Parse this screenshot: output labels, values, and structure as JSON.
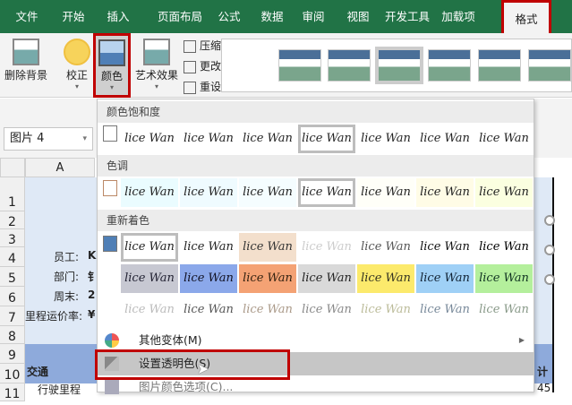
{
  "tabs": [
    "文件",
    "开始",
    "插入",
    "页面布局",
    "公式",
    "数据",
    "审阅",
    "视图",
    "开发工具",
    "加载项",
    "格式"
  ],
  "ribbon": {
    "remove_bg": "删除背景",
    "corrections": "校正",
    "color": "颜色",
    "artistic": "艺术效果",
    "compress": "压缩图片",
    "change": "更改图片",
    "reset": "重设图片"
  },
  "name_box": "图片 4",
  "column_a": "A",
  "rows": [
    "1",
    "2",
    "3",
    "4",
    "5",
    "6",
    "7",
    "8",
    "9",
    "10",
    "11"
  ],
  "cells": {
    "employee": "员工:",
    "dept": "部门:",
    "week": "周末:",
    "rate": "里程运价率:",
    "employee_v": "K",
    "dept_v": "钅",
    "week_v": "2",
    "rate_v": "¥",
    "traffic": "交通",
    "mileage": "行驶里程",
    "total": "计",
    "total_v": "45"
  },
  "menu": {
    "saturation": "颜色饱和度",
    "tone": "色调",
    "recolor": "重新着色",
    "sample": "lice Wan",
    "saturation_row": [
      {
        "bg": "#ffffff",
        "fg": "#222"
      },
      {
        "bg": "#ffffff",
        "fg": "#222"
      },
      {
        "bg": "#ffffff",
        "fg": "#222"
      },
      {
        "bg": "#ffffff",
        "fg": "#222",
        "sel": true
      },
      {
        "bg": "#ffffff",
        "fg": "#222"
      },
      {
        "bg": "#ffffff",
        "fg": "#222"
      },
      {
        "bg": "#ffffff",
        "fg": "#222"
      }
    ],
    "tone_row": [
      {
        "bg": "#eafcff",
        "fg": "#222"
      },
      {
        "bg": "#effbff",
        "fg": "#222"
      },
      {
        "bg": "#f5fdff",
        "fg": "#222"
      },
      {
        "bg": "#ffffff",
        "fg": "#222",
        "sel": true
      },
      {
        "bg": "#fffff8",
        "fg": "#222"
      },
      {
        "bg": "#fffce6",
        "fg": "#222"
      },
      {
        "bg": "#fbffe0",
        "fg": "#222"
      }
    ],
    "recolor_rows": [
      [
        {
          "bg": "#ffffff",
          "fg": "#222",
          "sel": true
        },
        {
          "bg": "#ffffff",
          "fg": "#222"
        },
        {
          "bg": "#f3dfcc",
          "fg": "#333"
        },
        {
          "bg": "#ffffff",
          "fg": "#ccc"
        },
        {
          "bg": "#ffffff",
          "fg": "#555"
        },
        {
          "bg": "#ffffff",
          "fg": "#111"
        },
        {
          "bg": "#ffffff",
          "fg": "#000"
        }
      ],
      [
        {
          "bg": "#c7c8d2",
          "fg": "#223"
        },
        {
          "bg": "#8ba8ea",
          "fg": "#112"
        },
        {
          "bg": "#f4a274",
          "fg": "#321"
        },
        {
          "bg": "#d9d9d9",
          "fg": "#222"
        },
        {
          "bg": "#fcea6c",
          "fg": "#332"
        },
        {
          "bg": "#9fd0f6",
          "fg": "#123"
        },
        {
          "bg": "#b4ef9c",
          "fg": "#132"
        }
      ],
      [
        {
          "bg": "#ffffff",
          "fg": "#bbb"
        },
        {
          "bg": "#ffffff",
          "fg": "#555"
        },
        {
          "bg": "#ffffff",
          "fg": "#a98"
        },
        {
          "bg": "#ffffff",
          "fg": "#888"
        },
        {
          "bg": "#ffffff",
          "fg": "#bb9"
        },
        {
          "bg": "#ffffff",
          "fg": "#789"
        },
        {
          "bg": "#ffffff",
          "fg": "#898"
        }
      ]
    ],
    "more_variants": "其他变体(M)",
    "set_transparent": "设置透明色(S)",
    "color_options": "图片颜色选项(C)..."
  },
  "colors": {
    "brand": "#217346",
    "highlight": "#c00000",
    "header_fill": "#8eaadb",
    "cell_fill": "#dfe9f6"
  }
}
